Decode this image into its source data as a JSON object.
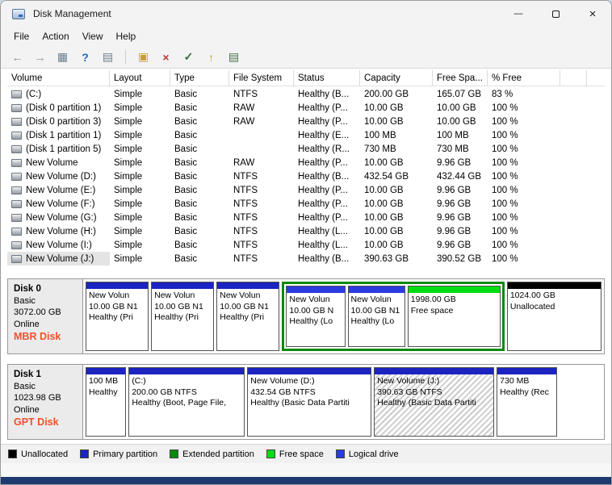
{
  "window": {
    "title": "Disk Management",
    "minimize_glyph": "—",
    "close_glyph": "×"
  },
  "menubar": {
    "items": [
      "File",
      "Action",
      "View",
      "Help"
    ]
  },
  "toolbar": {
    "items": [
      {
        "name": "back-icon",
        "glyph": "←",
        "color": "#8c8c8c"
      },
      {
        "name": "forward-icon",
        "glyph": "→",
        "color": "#8c8c8c"
      },
      {
        "name": "console-tree-icon",
        "glyph": "▦",
        "color": "#6b7d8f"
      },
      {
        "name": "help-icon",
        "glyph": "?",
        "color": "#1f66c1",
        "bold": true
      },
      {
        "name": "export-list-icon",
        "glyph": "▤",
        "color": "#6b7d8f"
      },
      {
        "separator": true
      },
      {
        "name": "action-pane-icon",
        "glyph": "▣",
        "color": "#c79f2a"
      },
      {
        "name": "delete-volume-icon",
        "glyph": "×",
        "color": "#c0392b",
        "bold": true
      },
      {
        "name": "mark-partition-icon",
        "glyph": "✓",
        "color": "#356e35",
        "bold": true
      },
      {
        "name": "extend-volume-icon",
        "glyph": "↑",
        "color": "#c79f2a",
        "bold": true
      },
      {
        "name": "properties-icon",
        "glyph": "▤",
        "color": "#4a6d4a"
      }
    ]
  },
  "table": {
    "columns": [
      "Volume",
      "Layout",
      "Type",
      "File System",
      "Status",
      "Capacity",
      "Free Spa...",
      "% Free"
    ],
    "rows": [
      {
        "cells": [
          "(C:)",
          "Simple",
          "Basic",
          "NTFS",
          "Healthy (B...",
          "200.00 GB",
          "165.07 GB",
          "83 %"
        ],
        "selected": false
      },
      {
        "cells": [
          "(Disk 0 partition 1)",
          "Simple",
          "Basic",
          "RAW",
          "Healthy (P...",
          "10.00 GB",
          "10.00 GB",
          "100 %"
        ],
        "selected": false
      },
      {
        "cells": [
          "(Disk 0 partition 3)",
          "Simple",
          "Basic",
          "RAW",
          "Healthy (P...",
          "10.00 GB",
          "10.00 GB",
          "100 %"
        ],
        "selected": false
      },
      {
        "cells": [
          "(Disk 1 partition 1)",
          "Simple",
          "Basic",
          "",
          "Healthy (E...",
          "100 MB",
          "100 MB",
          "100 %"
        ],
        "selected": false
      },
      {
        "cells": [
          "(Disk 1 partition 5)",
          "Simple",
          "Basic",
          "",
          "Healthy (R...",
          "730 MB",
          "730 MB",
          "100 %"
        ],
        "selected": false
      },
      {
        "cells": [
          "New Volume",
          "Simple",
          "Basic",
          "RAW",
          "Healthy (P...",
          "10.00 GB",
          "9.96 GB",
          "100 %"
        ],
        "selected": false
      },
      {
        "cells": [
          "New Volume (D:)",
          "Simple",
          "Basic",
          "NTFS",
          "Healthy (B...",
          "432.54 GB",
          "432.44 GB",
          "100 %"
        ],
        "selected": false
      },
      {
        "cells": [
          "New Volume (E:)",
          "Simple",
          "Basic",
          "NTFS",
          "Healthy (P...",
          "10.00 GB",
          "9.96 GB",
          "100 %"
        ],
        "selected": false
      },
      {
        "cells": [
          "New Volume (F:)",
          "Simple",
          "Basic",
          "NTFS",
          "Healthy (P...",
          "10.00 GB",
          "9.96 GB",
          "100 %"
        ],
        "selected": false
      },
      {
        "cells": [
          "New Volume (G:)",
          "Simple",
          "Basic",
          "NTFS",
          "Healthy (P...",
          "10.00 GB",
          "9.96 GB",
          "100 %"
        ],
        "selected": false
      },
      {
        "cells": [
          "New Volume (H:)",
          "Simple",
          "Basic",
          "NTFS",
          "Healthy (L...",
          "10.00 GB",
          "9.96 GB",
          "100 %"
        ],
        "selected": false
      },
      {
        "cells": [
          "New Volume (I:)",
          "Simple",
          "Basic",
          "NTFS",
          "Healthy (L...",
          "10.00 GB",
          "9.96 GB",
          "100 %"
        ],
        "selected": false
      },
      {
        "cells": [
          "New Volume (J:)",
          "Simple",
          "Basic",
          "NTFS",
          "Healthy (B...",
          "390.63 GB",
          "390.52 GB",
          "100 %"
        ],
        "selected": true
      }
    ]
  },
  "disks": [
    {
      "header": {
        "name": "Disk 0",
        "type": "Basic",
        "size": "3072.00 GB",
        "status": "Online",
        "style": "MBR Disk"
      },
      "segments": [
        {
          "kind": "primary",
          "size": 78,
          "lines": [
            "New Volun",
            "10.00 GB N1",
            "Healthy (Pri"
          ]
        },
        {
          "kind": "primary",
          "size": 78,
          "lines": [
            "New Volun",
            "10.00 GB N1",
            "Healthy (Pri"
          ]
        },
        {
          "kind": "primary",
          "size": 78,
          "lines": [
            "New Volun",
            "10.00 GB N1",
            "Healthy (Pri"
          ]
        },
        {
          "kind": "extended",
          "size": 272,
          "children": [
            {
              "kind": "logical",
              "size": 73,
              "lines": [
                "New Volun",
                "10.00 GB N",
                "Healthy (Lo"
              ]
            },
            {
              "kind": "logical",
              "size": 71,
              "lines": [
                "New Volun",
                "10.00 GB N1",
                "Healthy (Lo"
              ]
            },
            {
              "kind": "free",
              "size": 116,
              "lines": [
                "1998.00 GB",
                "Free space"
              ]
            }
          ]
        },
        {
          "kind": "unallocated",
          "size": 118,
          "lines": [
            "1024.00 GB",
            "Unallocated"
          ]
        }
      ]
    },
    {
      "header": {
        "name": "Disk 1",
        "type": "Basic",
        "size": "1023.98 GB",
        "status": "Online",
        "style": "GPT Disk"
      },
      "segments": [
        {
          "kind": "primary",
          "size": 48,
          "lines": [
            "100 MB",
            "Healthy"
          ]
        },
        {
          "kind": "primary",
          "size": 141,
          "lines": [
            "(C:)",
            "200.00 GB NTFS",
            "Healthy (Boot, Page File,"
          ]
        },
        {
          "kind": "primary",
          "size": 151,
          "lines": [
            "New Volume  (D:)",
            "432.54 GB NTFS",
            "Healthy (Basic Data Partiti"
          ]
        },
        {
          "kind": "primary",
          "size": 146,
          "selected": true,
          "lines": [
            "New Volume (J:)",
            "390.63 GB NTFS",
            "Healthy (Basic Data Partiti"
          ]
        },
        {
          "kind": "primary",
          "size": 72,
          "lines": [
            "730 MB",
            "Healthy (Rec"
          ]
        },
        {
          "kind": "spacer",
          "size": 52
        }
      ]
    }
  ],
  "legend": {
    "items": [
      {
        "label": "Unallocated",
        "kind": "unallocated"
      },
      {
        "label": "Primary partition",
        "kind": "primary"
      },
      {
        "label": "Extended partition",
        "kind": "extended"
      },
      {
        "label": "Free space",
        "kind": "free"
      },
      {
        "label": "Logical drive",
        "kind": "logical"
      }
    ]
  },
  "colors": {
    "primary": "#1b24c0",
    "logical": "#2b3ce0",
    "extended": "#0c8a0c",
    "free": "#00dc14",
    "unallocated": "#000000",
    "disk_style_label": "#f4502c"
  }
}
